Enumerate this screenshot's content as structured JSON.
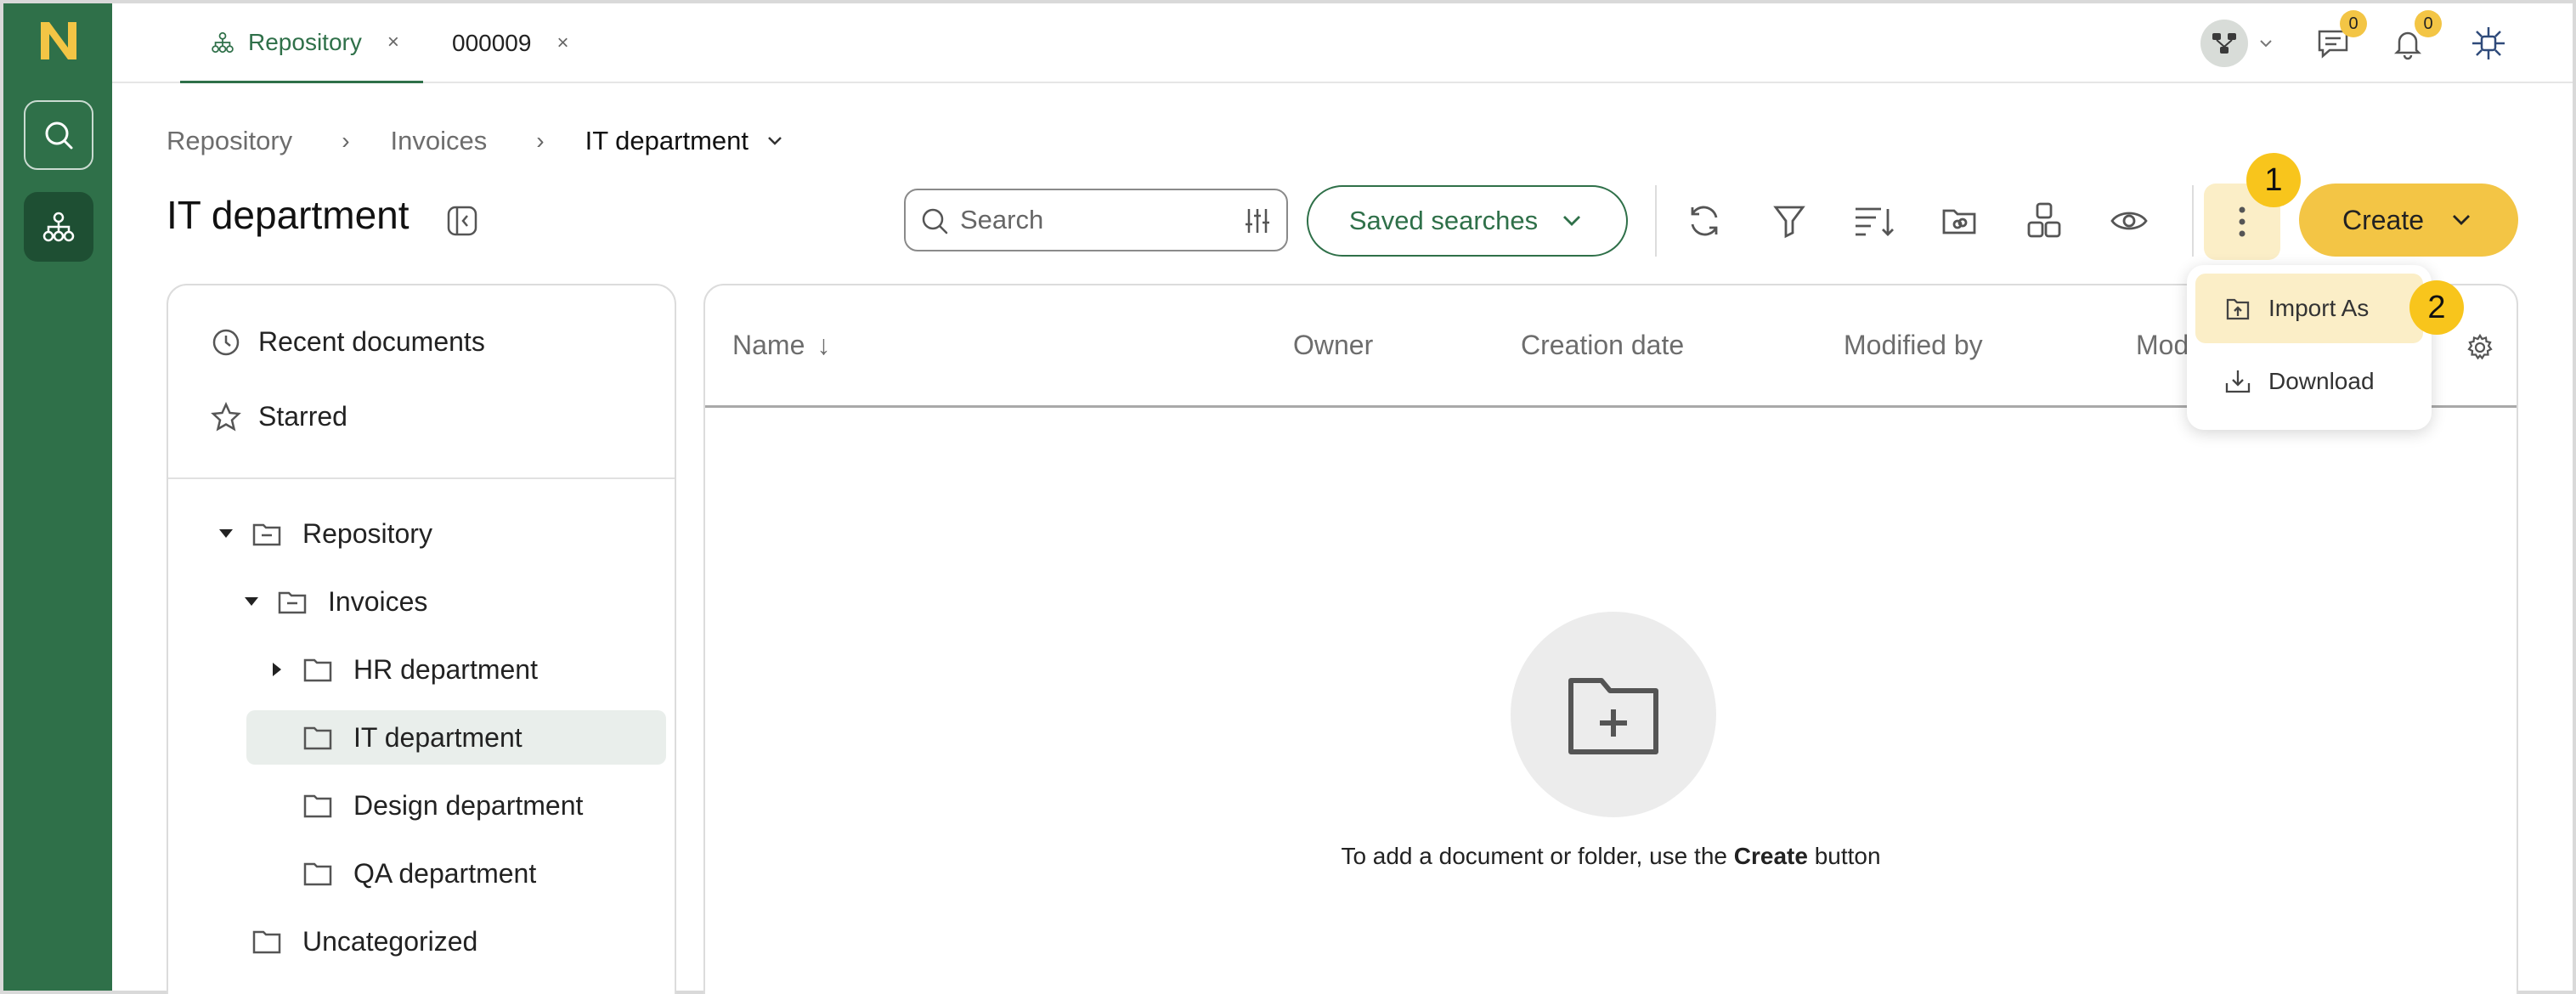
{
  "app": {
    "logo_letter": "N",
    "accent": "#2f7049",
    "highlight": "#f3c545"
  },
  "tabs": [
    {
      "label": "Repository",
      "close": "×"
    },
    {
      "label": "000009",
      "close": "×"
    }
  ],
  "header": {
    "messages_count": "0",
    "notifications_count": "0"
  },
  "breadcrumb": {
    "items": [
      "Repository",
      "Invoices",
      "IT department"
    ],
    "separator": "›"
  },
  "page_title": "IT department",
  "toolbar": {
    "search_placeholder": "Search",
    "saved_searches_label": "Saved searches",
    "create_label": "Create"
  },
  "steps": {
    "one": "1",
    "two": "2"
  },
  "menu": {
    "items": [
      "Import As",
      "Download"
    ]
  },
  "sidebar": {
    "quick": [
      "Recent documents",
      "Starred"
    ],
    "tree": [
      "Repository",
      "Invoices",
      "HR department",
      "IT department",
      "Design department",
      "QA department",
      "Uncategorized"
    ]
  },
  "table": {
    "columns": [
      "Name",
      "Owner",
      "Creation date",
      "Modified by",
      "Mod"
    ],
    "sort_arrow": "↓"
  },
  "empty": {
    "prefix": "To add a document or folder, use the ",
    "bold": "Create",
    "suffix": " button"
  }
}
